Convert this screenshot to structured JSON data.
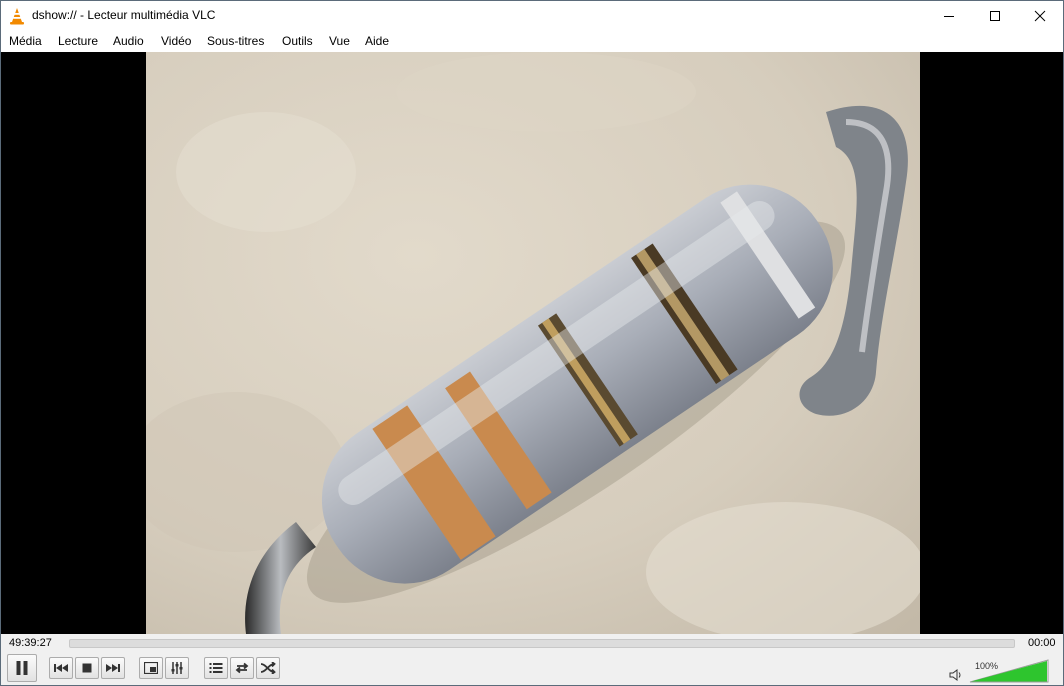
{
  "window": {
    "title": "dshow:// - Lecteur multimédia VLC"
  },
  "menu": {
    "items": [
      {
        "label": "Média",
        "accel": "M"
      },
      {
        "label": "Lecture",
        "accel": "L"
      },
      {
        "label": "Audio",
        "accel": "A"
      },
      {
        "label": "Vidéo",
        "accel": "V"
      },
      {
        "label": "Sous-titres",
        "accel": "t"
      },
      {
        "label": "Outils",
        "accel": "O"
      },
      {
        "label": "Vue",
        "accel": "u"
      },
      {
        "label": "Aide",
        "accel": "i"
      }
    ]
  },
  "playback": {
    "elapsed": "49:39:27",
    "total": "00:00",
    "progress": 0
  },
  "volume": {
    "label": "100%",
    "level": 1.0,
    "color": "#2ec52e"
  },
  "icons": {
    "app": "vlc-cone-icon",
    "minimize": "minimize-icon",
    "maximize": "maximize-icon",
    "close": "close-icon",
    "pause": "pause-icon",
    "previous": "previous-icon",
    "stop": "stop-icon",
    "next": "next-icon",
    "fullscreen": "fullscreen-icon",
    "extended": "extended-settings-icon",
    "playlist": "playlist-icon",
    "loop": "loop-icon",
    "shuffle": "shuffle-icon",
    "speaker": "speaker-icon"
  }
}
